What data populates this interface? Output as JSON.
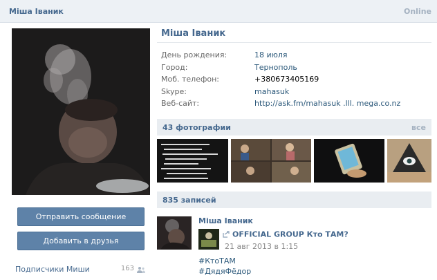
{
  "header": {
    "name": "Міша Іваник",
    "status": "Online"
  },
  "actions": {
    "send_message": "Отправить сообщение",
    "add_friend": "Добавить в друзья"
  },
  "subscribers": {
    "label": "Подписчики Миши",
    "count": "163"
  },
  "profile": {
    "name": "Міша Іваник",
    "info": [
      {
        "label": "День рождения:",
        "value": "18 июля",
        "link": true
      },
      {
        "label": "Город:",
        "value": "Тернополь",
        "link": true
      },
      {
        "label": "Моб. телефон:",
        "value": "+380673405169",
        "link": false
      },
      {
        "label": "Skype:",
        "value": "mahasuk",
        "link": true
      },
      {
        "label": "Веб-сайт:",
        "value": "http://ask.fm/mahasuk .lll. mega.co.nz",
        "link": true
      }
    ]
  },
  "photos": {
    "title": "43 фотографии",
    "all": "все"
  },
  "posts": {
    "title": "835 записей",
    "items": [
      {
        "author": "Міша Іваник",
        "repost_group": "OFFICIAL GROUP Кто ТАМ?",
        "date": "21 авг 2013 в 1:15",
        "tags": [
          "#КтоТАМ",
          "#ДядяФёдор"
        ]
      }
    ]
  },
  "colors": {
    "link": "#45688e",
    "button": "#5e82a8",
    "section_bg": "#e9edf1",
    "header_bg": "#edf1f5"
  }
}
